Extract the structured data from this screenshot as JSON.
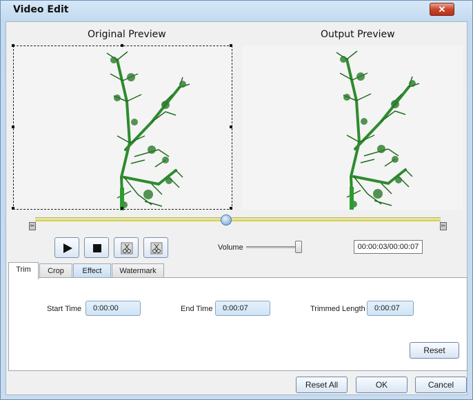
{
  "window": {
    "title": "Video Edit",
    "close_glyph": "✕"
  },
  "preview": {
    "original_label": "Original Preview",
    "output_label": "Output Preview"
  },
  "playback": {
    "volume_label": "Volume",
    "volume_level": 0.95,
    "seek_position": 0.43,
    "time_display": "00:00:03/00:00:07"
  },
  "tabs": [
    "Trim",
    "Crop",
    "Effect",
    "Watermark"
  ],
  "trim": {
    "start_label": "Start Time",
    "start_value": "0:00:00",
    "end_label": "End Time",
    "end_value": "0:00:07",
    "length_label": "Trimmed Length",
    "length_value": "0:00:07",
    "reset_label": "Reset"
  },
  "footer": {
    "reset_all_label": "Reset All",
    "ok_label": "OK",
    "cancel_label": "Cancel"
  },
  "icons": {
    "play": "play-icon",
    "stop": "stop-icon",
    "trim_start": "scissors-start-icon",
    "trim_end": "scissors-end-icon"
  }
}
